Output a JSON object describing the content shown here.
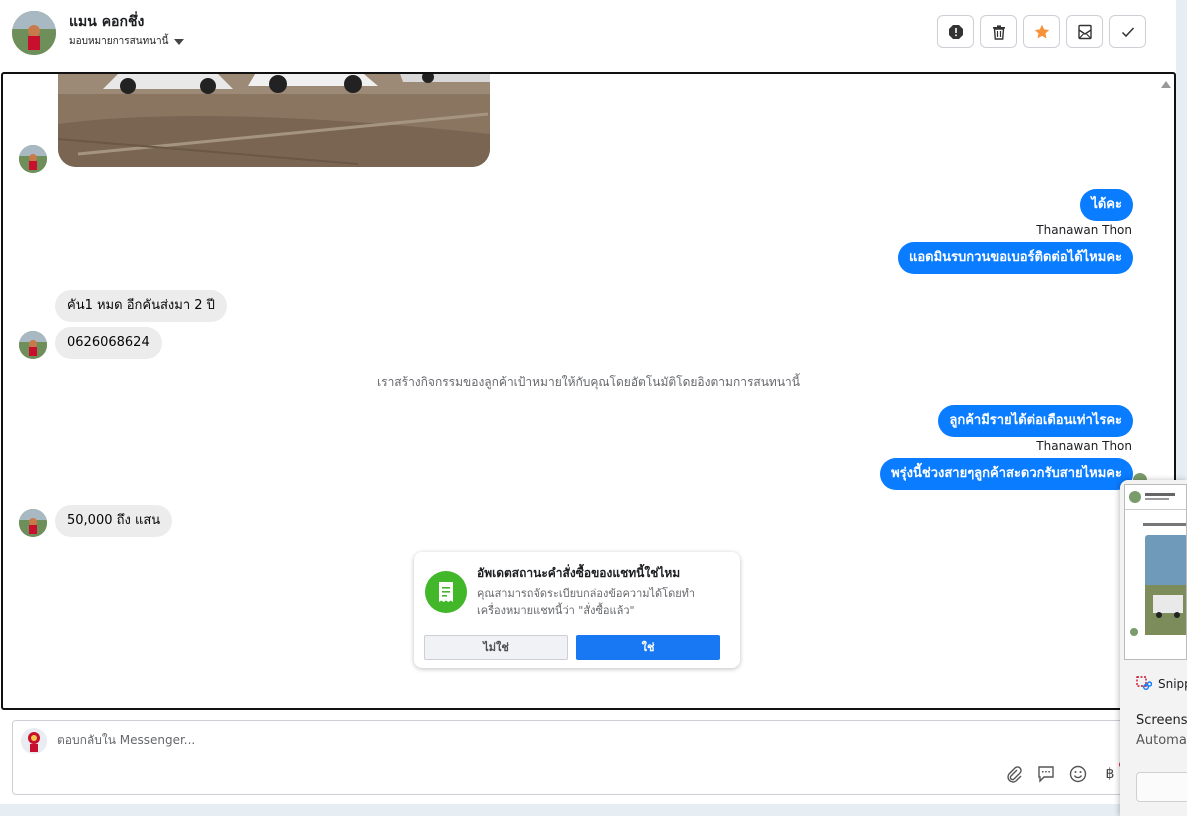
{
  "header": {
    "contact_name": "แมน คอกชึ่ง",
    "assign_label": "มอบหมายการสนทนานี้",
    "actions": [
      "spam-icon",
      "trash-icon",
      "star-icon",
      "mark-unread-icon",
      "check-icon"
    ],
    "star_color": "#f7923a"
  },
  "messages": {
    "out_1": "ได้คะ",
    "sender_1": "Thanawan Thon",
    "out_2": "แอดมินรบกวนขอเบอร์ติดต่อได้ไหมคะ",
    "in_1": "คัน1 หมด  อีกคันส่งมา 2 ปี",
    "in_2": "0626068624",
    "system_note": "เราสร้างกิจกรรมของลูกค้าเป้าหมายให้กับคุณโดยอัตโนมัติโดยอิงตามการสนทนานี้",
    "out_3": "ลูกค้ามีรายได้ต่อเดือนเท่าไรคะ",
    "sender_2": "Thanawan Thon",
    "out_4": "พรุ่งนี้ช่วงสายๆลูกค้าสะดวกรับสายไหมคะ",
    "in_3": "50,000  ถึง  แสน"
  },
  "prompt_card": {
    "title": "อัพเดตสถานะคำสั่งซื้อของแชทนี้ใช่ไหม",
    "description": "คุณสามารถจัดระเบียบกล่องข้อความได้โดยทำเครื่องหมายแชทนี้ว่า \"สั่งซื้อแล้ว\"",
    "no_label": "ไม่ใช่",
    "yes_label": "ใช่"
  },
  "composer": {
    "placeholder": "ตอบกลับใน Messenger...",
    "tools": [
      "attach-icon",
      "saved-reply-icon",
      "emoji-icon",
      "baht-icon"
    ],
    "baht_symbol": "฿"
  },
  "snipping_tool": {
    "app_name": "Snipp",
    "heading": "Screensh",
    "subtext": "Automat"
  },
  "colors": {
    "outgoing_bubble": "#0a7cff",
    "incoming_bubble": "#ececec",
    "yes_button": "#1877f2",
    "card_icon": "#42b72a"
  }
}
